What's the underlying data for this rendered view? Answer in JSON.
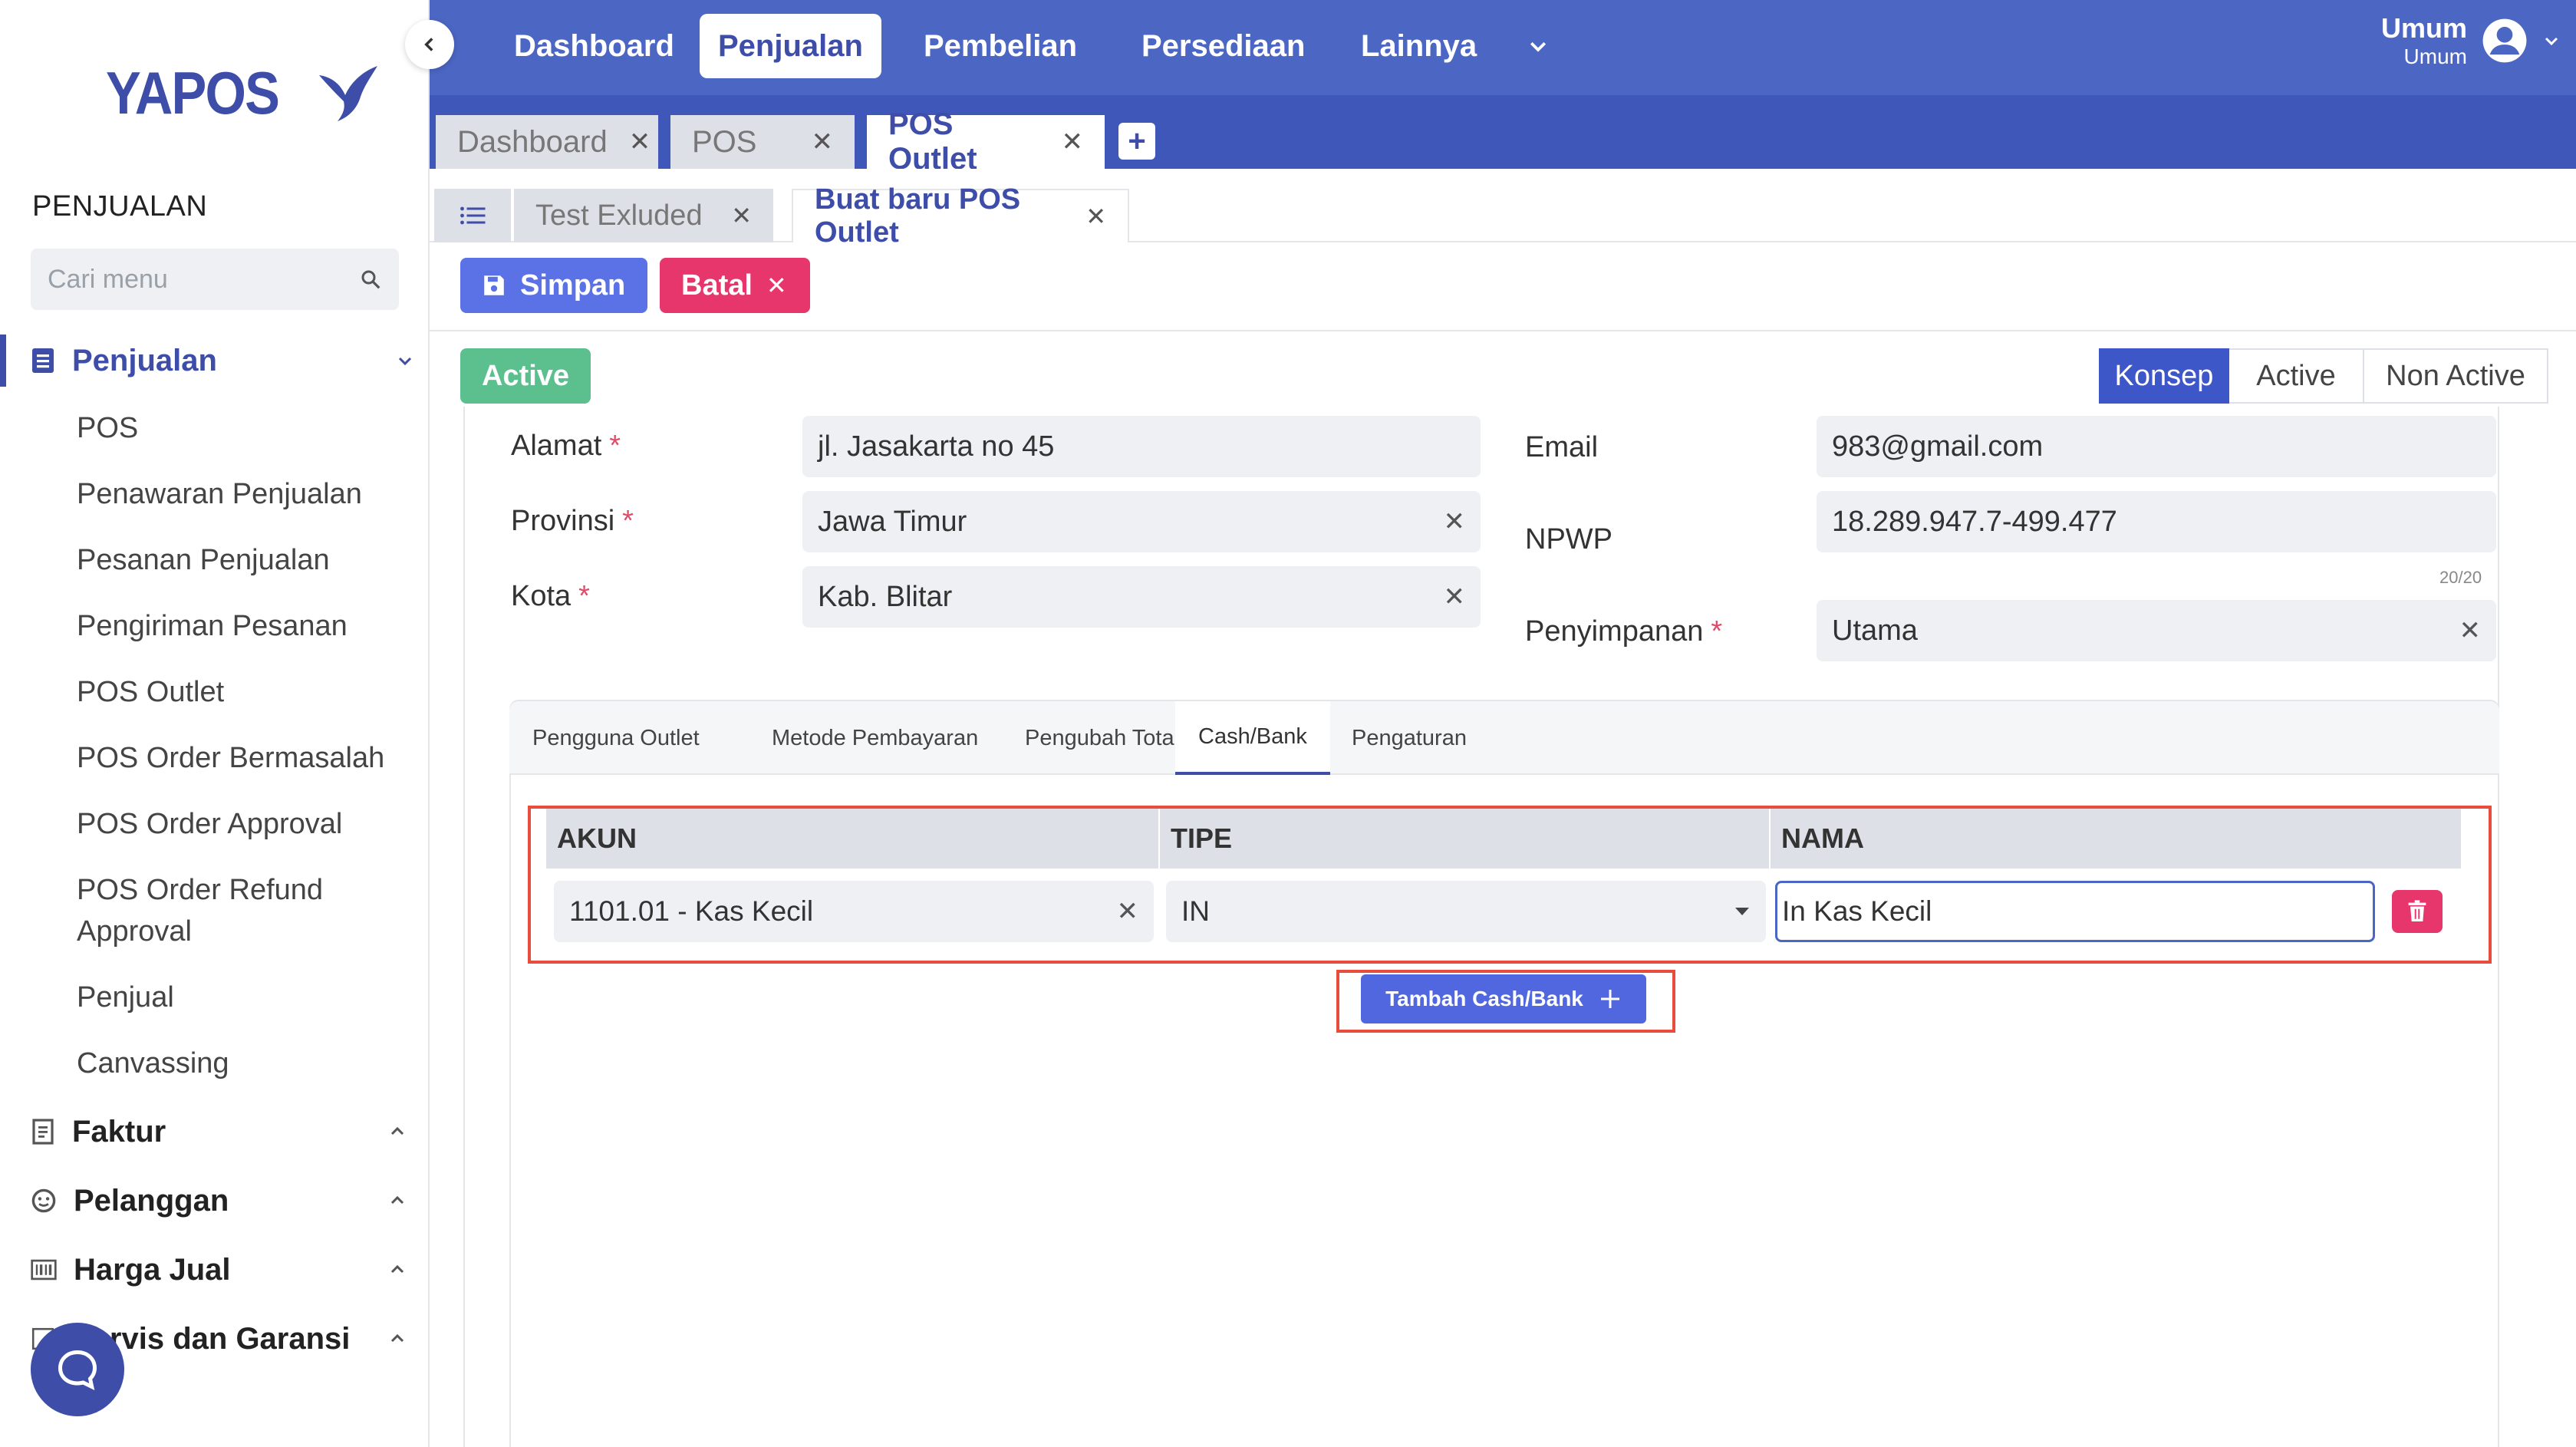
{
  "brand": {
    "logo_text": "YAPOS",
    "accent": "#3d4da8"
  },
  "sidebar": {
    "section_title": "PENJUALAN",
    "search_placeholder": "Cari menu",
    "active_group": "Penjualan",
    "sub_items": [
      "POS",
      "Penawaran Penjualan",
      "Pesanan Penjualan",
      "Pengiriman Pesanan",
      "POS Outlet",
      "POS Order Bermasalah",
      "POS Order Approval",
      "POS Order Refund",
      "Approval",
      "Penjual",
      "Canvassing"
    ],
    "groups": [
      "Faktur",
      "Pelanggan",
      "Harga Jual",
      "Servis dan Garansi"
    ]
  },
  "topnav": {
    "items": [
      "Dashboard",
      "Penjualan",
      "Pembelian",
      "Persediaan",
      "Lainnya"
    ],
    "active": "Penjualan",
    "user_name": "Umum",
    "user_role": "Umum"
  },
  "tabs": [
    "Dashboard",
    "POS",
    "POS Outlet"
  ],
  "subtabs": [
    "Test Exluded",
    "Buat baru POS Outlet"
  ],
  "toolbar": {
    "save_label": "Simpan",
    "cancel_label": "Batal"
  },
  "status": {
    "badge": "Active",
    "steps": [
      "Konsep",
      "Active",
      "Non Active"
    ],
    "current_step": "Konsep"
  },
  "form": {
    "alamat_label": "Alamat",
    "alamat_value": "jl. Jasakarta no 45",
    "provinsi_label": "Provinsi",
    "provinsi_value": "Jawa Timur",
    "kota_label": "Kota",
    "kota_value": "Kab. Blitar",
    "email_label": "Email",
    "email_value": "983@gmail.com",
    "npwp_label": "NPWP",
    "npwp_value": "18.289.947.7-499.477",
    "npwp_counter": "20/20",
    "penyimpanan_label": "Penyimpanan",
    "penyimpanan_value": "Utama",
    "required_mark": "*"
  },
  "panel": {
    "tabs": [
      "Pengguna Outlet",
      "Metode Pembayaran",
      "Pengubah Total",
      "Cash/Bank",
      "Pengaturan"
    ],
    "active_tab": "Cash/Bank",
    "columns": [
      "AKUN",
      "TIPE",
      "NAMA"
    ],
    "rows": [
      {
        "akun": "1101.01 - Kas Kecil",
        "tipe": "IN",
        "nama": "In Kas Kecil"
      }
    ],
    "add_label": "Tambah Cash/Bank"
  },
  "colors": {
    "topnav": "#4c66c4",
    "tabbar": "#3f57b8",
    "danger": "#e6366b",
    "success": "#5bbf8e",
    "highlight": "#e74c3c"
  }
}
